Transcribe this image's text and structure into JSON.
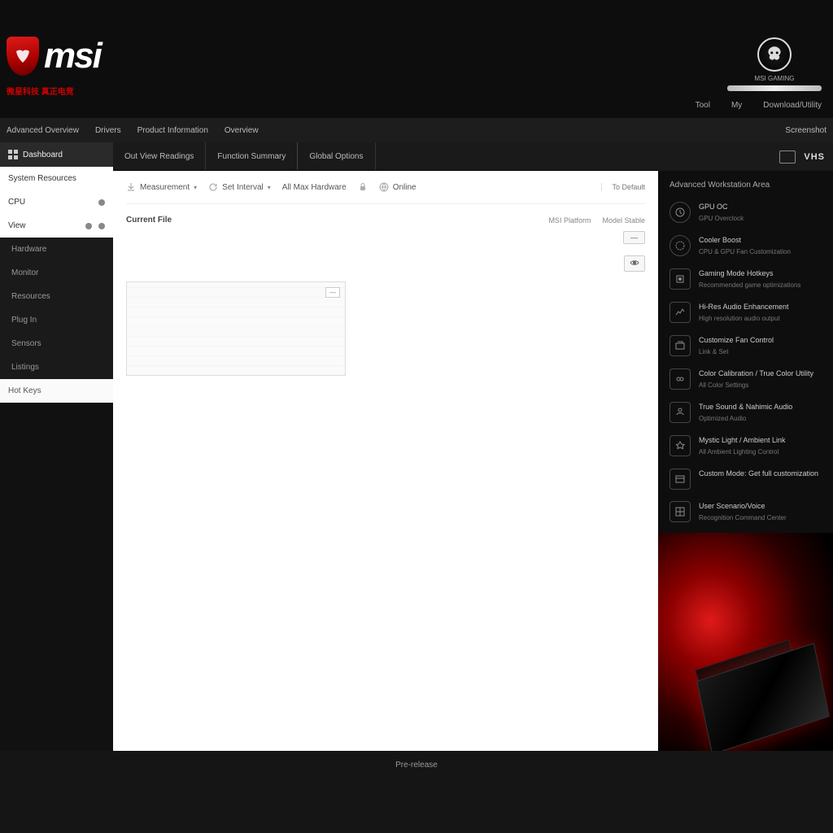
{
  "brand": {
    "name": "msi",
    "sub": "微星科技 真正电竞",
    "tagline": "",
    "badge_label": "MSI GAMING"
  },
  "header_nav": [
    "Tool",
    "My",
    "Download/Utility"
  ],
  "topnav": {
    "items": [
      "Advanced Overview",
      "Drivers",
      "Product Information",
      "Overview"
    ],
    "right": "Screenshot"
  },
  "sidebar": {
    "active": {
      "icon": "grid",
      "label": "Dashboard"
    },
    "sub": [
      {
        "label": "System Resources"
      },
      {
        "label": "CPU",
        "dot": true
      },
      {
        "label": "View",
        "dot": true
      }
    ],
    "groups": [
      [
        "Hardware",
        "Monitor",
        "Resources",
        "Plug In",
        "Sensors",
        "Listings"
      ],
      [
        "Hot Keys"
      ]
    ]
  },
  "tabs": [
    "Out View Readings",
    "Function Summary",
    "Global Options"
  ],
  "toolbar": {
    "items": [
      {
        "icon": "download",
        "label": "Measurement",
        "caret": true
      },
      {
        "icon": "refresh",
        "label": "Set Interval",
        "caret": true
      },
      {
        "icon": "",
        "label": "All Max Hardware"
      },
      {
        "icon": "lock",
        "label": ""
      },
      {
        "icon": "globe",
        "label": "Online"
      }
    ],
    "right": "To Default"
  },
  "section": {
    "title": "Current File",
    "meta1": "MSI Platform",
    "meta2": "Model Stable",
    "btn": "—"
  },
  "chart": {
    "badge": "—"
  },
  "rightcol": {
    "label": "VHS",
    "title": "Advanced Workstation Area",
    "features": [
      {
        "t1": "GPU OC",
        "t2": "GPU Overclock"
      },
      {
        "t1": "Cooler Boost",
        "t2": "CPU & GPU Fan Customization"
      },
      {
        "t1": "Gaming Mode Hotkeys",
        "t2": "Recommended game optimizations"
      },
      {
        "t1": "Hi-Res Audio Enhancement",
        "t2": "High resolution audio output"
      },
      {
        "t1": "Customize Fan Control",
        "t2": "Link & Set"
      },
      {
        "t1": "Color Calibration / True Color Utility",
        "t2": "All Color Settings"
      },
      {
        "t1": "True Sound & Nahimic Audio",
        "t2": "Optimized Audio"
      },
      {
        "t1": "Mystic Light / Ambient Link",
        "t2": "All Ambient Lighting Control"
      },
      {
        "t1": "Custom Mode: Get full customization",
        "t2": ""
      },
      {
        "t1": "User Scenario/Voice",
        "t2": "Recognition Command Center"
      }
    ]
  },
  "footer": "Pre-release"
}
